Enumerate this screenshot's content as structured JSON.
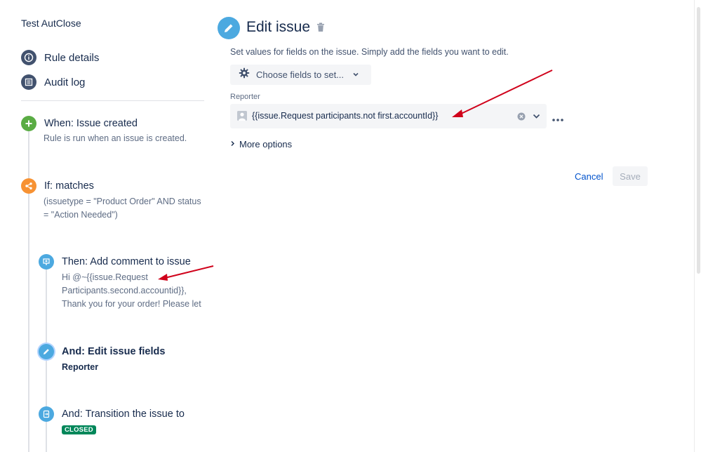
{
  "sidebar": {
    "rule_title": "Test AutClose",
    "nav": [
      {
        "label": "Rule details",
        "icon": "info-icon"
      },
      {
        "label": "Audit log",
        "icon": "list-icon"
      }
    ],
    "steps": [
      {
        "title": "When: Issue created",
        "desc": "Rule is run when an issue is created.",
        "icon": "plus-icon",
        "color": "#5aac44"
      },
      {
        "title": "If: matches",
        "desc": "(issuetype = \"Product Order\" AND status = \"Action Needed\")",
        "icon": "share-icon",
        "color": "#f79233"
      },
      {
        "title": "Then: Add comment to issue",
        "desc_lines": [
          "Hi @~{{issue.Request",
          "Participants.second.accountid}},",
          "Thank you for your order! Please let"
        ],
        "icon": "comment-icon",
        "color": "#4ca9e0"
      },
      {
        "title": "And: Edit issue fields",
        "desc": "Reporter",
        "icon": "pencil-icon",
        "color": "#4ca9e0"
      },
      {
        "title": "And: Transition the issue to",
        "badge": "CLOSED",
        "icon": "transition-icon",
        "color": "#4ca9e0"
      }
    ]
  },
  "main": {
    "title": "Edit issue",
    "description": "Set values for fields on the issue. Simply add the fields you want to edit.",
    "choose_fields_label": "Choose fields to set...",
    "field": {
      "label": "Reporter",
      "value": "{{issue.Request participants.not first.accountId}}"
    },
    "more_options_label": "More options",
    "cancel_label": "Cancel",
    "save_label": "Save"
  },
  "colors": {
    "accent": "#0052cc",
    "success": "#00875a",
    "annotation_arrow": "#d0021b"
  }
}
